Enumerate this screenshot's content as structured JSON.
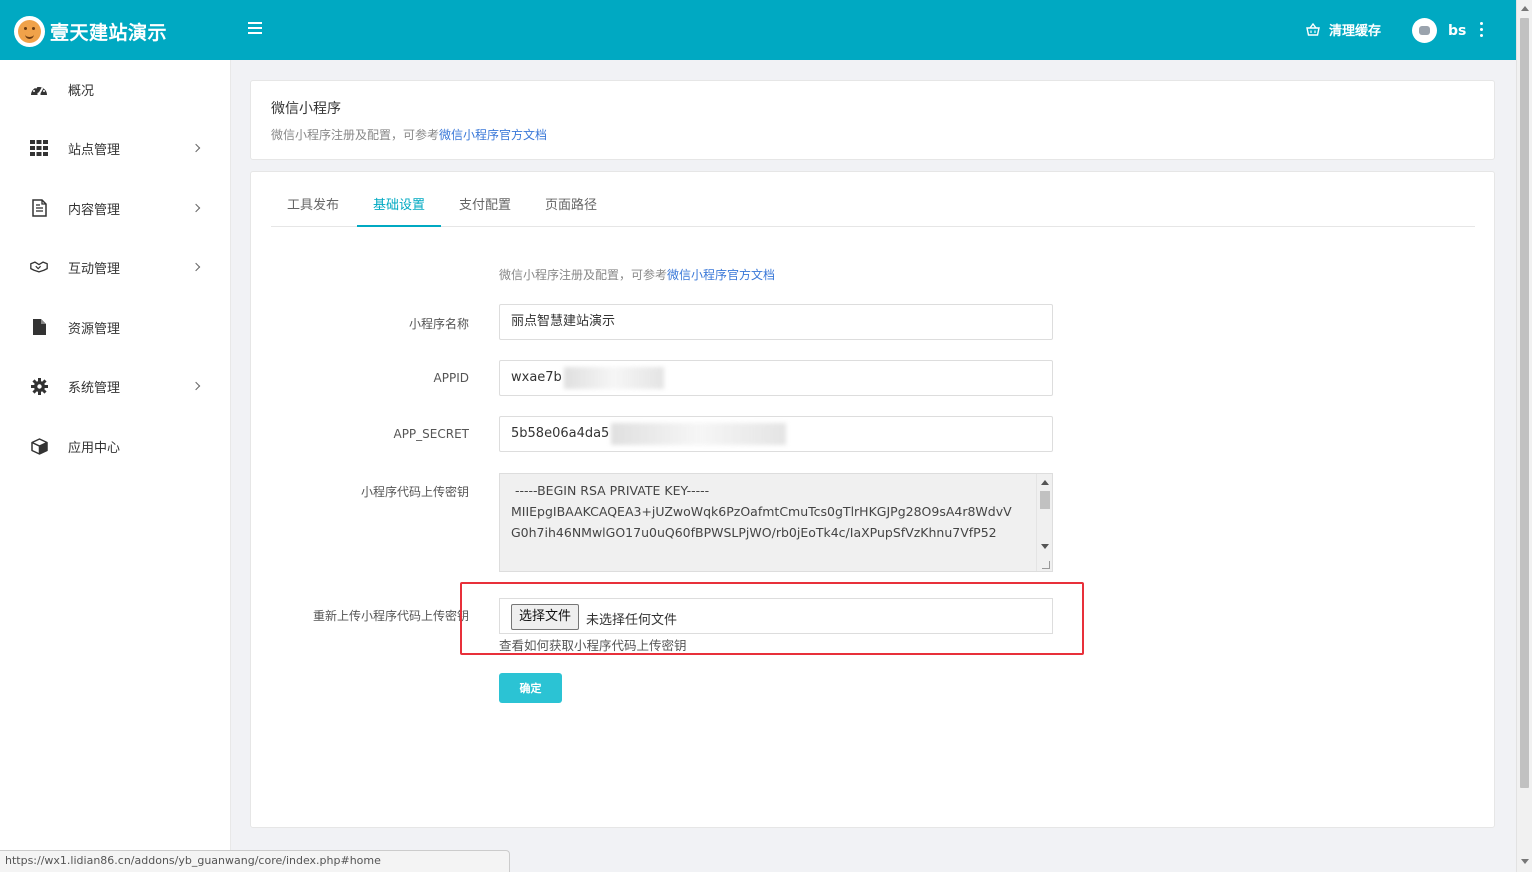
{
  "brand": {
    "title": "壹天建站演示"
  },
  "topbar": {
    "clear_cache": "清理缓存",
    "username": "bs"
  },
  "sidebar": {
    "items": [
      {
        "label": "概况",
        "icon": "dashboard-icon",
        "has_children": false
      },
      {
        "label": "站点管理",
        "icon": "grid-icon",
        "has_children": true
      },
      {
        "label": "内容管理",
        "icon": "document-icon",
        "has_children": true
      },
      {
        "label": "互动管理",
        "icon": "handshake-icon",
        "has_children": true
      },
      {
        "label": "资源管理",
        "icon": "file-icon",
        "has_children": false
      },
      {
        "label": "系统管理",
        "icon": "gear-icon",
        "has_children": true
      },
      {
        "label": "应用中心",
        "icon": "cube-icon",
        "has_children": false
      }
    ]
  },
  "header": {
    "title": "微信小程序",
    "desc_prefix": "微信小程序注册及配置，可参考",
    "desc_link": "微信小程序官方文档"
  },
  "tabs": [
    {
      "label": "工具发布",
      "active": false
    },
    {
      "label": "基础设置",
      "active": true
    },
    {
      "label": "支付配置",
      "active": false
    },
    {
      "label": "页面路径",
      "active": false
    }
  ],
  "form": {
    "note_prefix": "微信小程序注册及配置，可参考",
    "note_link": "微信小程序官方文档",
    "name_label": "小程序名称",
    "name_value": "丽点智慧建站演示",
    "appid_label": "APPID",
    "appid_value": "wxae7b",
    "secret_label": "APP_SECRET",
    "secret_value": "5b58e06a4da5",
    "key_label": "小程序代码上传密钥",
    "key_value": " -----BEGIN RSA PRIVATE KEY-----\nMIIEpgIBAAKCAQEA3+jUZwoWqk6PzOafmtCmuTcs0gTlrHKGJPg28O9sA4r8WdvV\nG0h7ih46NMwlGO17u0uQ60fBPWSLPjWO/rb0jEoTk4c/IaXPupSfVzKhnu7VfP52",
    "reupload_label": "重新上传小程序代码上传密钥",
    "file_button": "选择文件",
    "file_status": "未选择任何文件",
    "file_help": "查看如何获取小程序代码上传密钥",
    "submit": "确定"
  },
  "statusbar": {
    "url": "https://wx1.lidian86.cn/addons/yb_guanwang/core/index.php#home"
  },
  "colors": {
    "primary": "#00a9c2",
    "button": "#2bc3d4",
    "highlight": "#e8303a",
    "link": "#3a78d8"
  }
}
